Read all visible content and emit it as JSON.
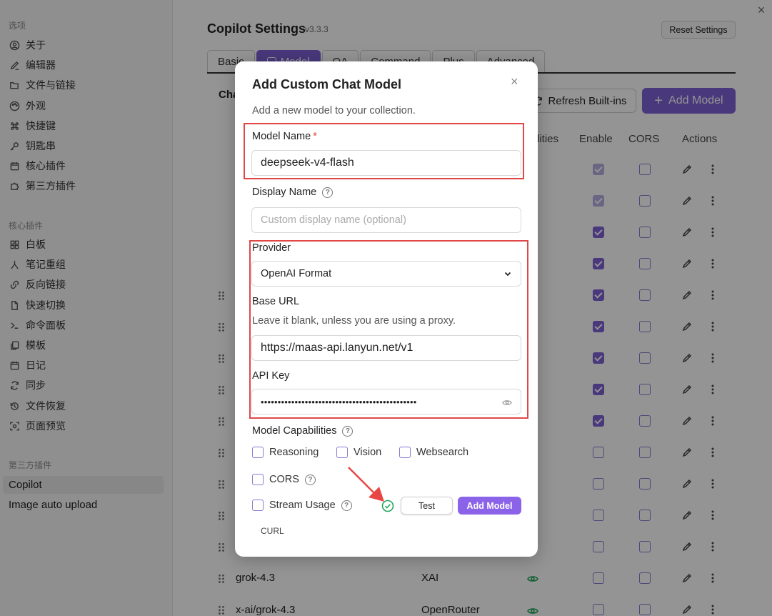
{
  "sidebar": {
    "group_options": "选项",
    "options": [
      {
        "label": "关于",
        "icon": "user-icon"
      },
      {
        "label": "编辑器",
        "icon": "pencil-icon"
      },
      {
        "label": "文件与链接",
        "icon": "folder-link-icon"
      },
      {
        "label": "外观",
        "icon": "palette-icon"
      },
      {
        "label": "快捷键",
        "icon": "command-icon"
      },
      {
        "label": "钥匙串",
        "icon": "key-icon"
      },
      {
        "label": "核心插件",
        "icon": "calendar-icon"
      },
      {
        "label": "第三方插件",
        "icon": "puzzle-icon"
      }
    ],
    "group_core": "核心插件",
    "core_plugins": [
      {
        "label": "白板",
        "icon": "grid-icon"
      },
      {
        "label": "笔记重组",
        "icon": "merge-icon"
      },
      {
        "label": "反向链接",
        "icon": "backlink-icon"
      },
      {
        "label": "快速切换",
        "icon": "file-switch-icon"
      },
      {
        "label": "命令面板",
        "icon": "terminal-icon"
      },
      {
        "label": "模板",
        "icon": "template-icon"
      },
      {
        "label": "日记",
        "icon": "calendar-icon"
      },
      {
        "label": "同步",
        "icon": "sync-icon"
      },
      {
        "label": "文件恢复",
        "icon": "history-icon"
      },
      {
        "label": "页面预览",
        "icon": "preview-icon"
      }
    ],
    "group_third": "第三方插件",
    "third_plugins": [
      {
        "label": "Copilot",
        "active": true
      },
      {
        "label": "Image auto upload",
        "active": false
      }
    ]
  },
  "header": {
    "title": "Copilot Settings",
    "version": "v3.3.3",
    "reset_label": "Reset Settings",
    "close_icon": "×"
  },
  "tabs": [
    "Basic",
    "Model",
    "QA",
    "Command",
    "Plus",
    "Advanced"
  ],
  "section": {
    "title": "Cha",
    "refresh_label": "Refresh Built-ins",
    "add_model_label": "Add Model"
  },
  "table": {
    "columns": {
      "capabilities": "lities",
      "enable": "Enable",
      "cors": "CORS",
      "actions": "Actions"
    },
    "visible_rows": [
      {
        "model": "grok-4.3",
        "provider": "XAI"
      },
      {
        "model": "x-ai/grok-4.3",
        "provider": "OpenRouter"
      }
    ]
  },
  "modal": {
    "title": "Add Custom Chat Model",
    "subtitle": "Add a new model to your collection.",
    "close_icon": "×",
    "model_name_label": "Model Name",
    "required_mark": "*",
    "model_name_value": "deepseek-v4-flash",
    "display_name_label": "Display Name",
    "display_name_placeholder": "Custom display name (optional)",
    "provider_label": "Provider",
    "provider_value": "OpenAI Format",
    "base_url_label": "Base URL",
    "base_url_help": "Leave it blank, unless you are using a proxy.",
    "base_url_value": "https://maas-api.lanyun.net/v1",
    "api_key_label": "API Key",
    "api_key_value": "••••••••••••••••••••••••••••••••••••••••••••••",
    "capabilities_label": "Model Capabilities",
    "capabilities": [
      "Reasoning",
      "Vision",
      "Websearch"
    ],
    "cors_label": "CORS",
    "stream_usage_label": "Stream Usage",
    "test_label": "Test",
    "add_label": "Add Model",
    "curl_label": "CURL",
    "help_icon": "?"
  },
  "colors": {
    "accent": "#7e61d6",
    "add_button": "#8b63e8",
    "highlight_box": "#e04848",
    "success": "#22a65a",
    "eye": "#23a55a"
  }
}
